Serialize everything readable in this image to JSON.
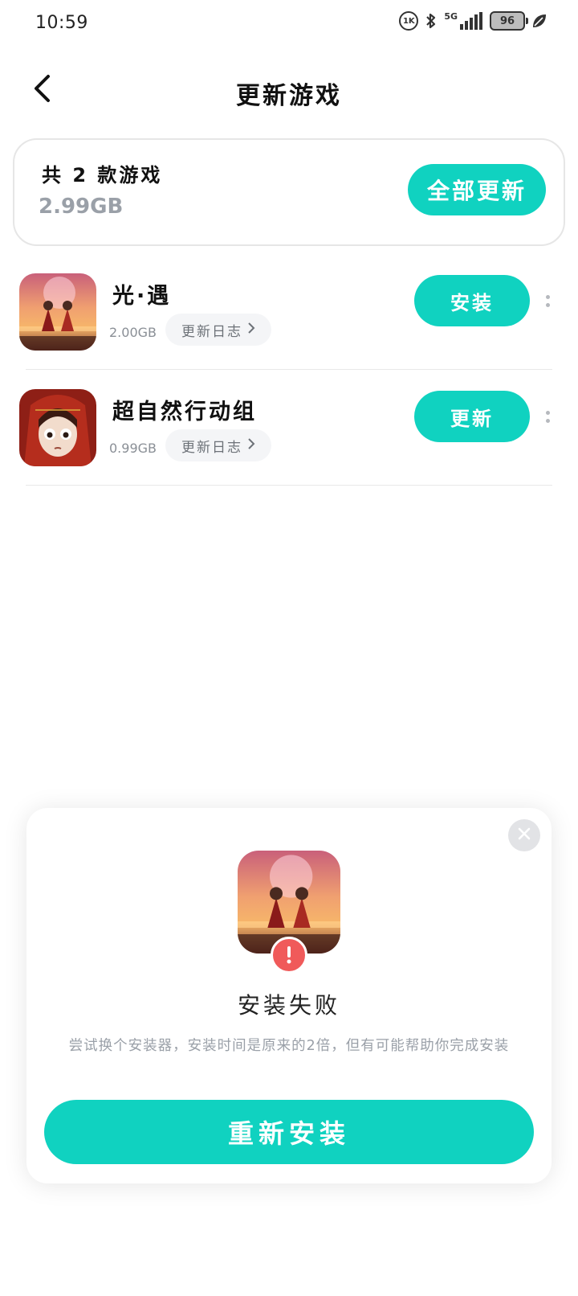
{
  "status_bar": {
    "time": "10:59",
    "hd_label": "1K",
    "network_label": "5G",
    "battery_level": "96",
    "icons": [
      "hd-icon",
      "bluetooth-icon",
      "signal-icon",
      "battery-icon",
      "leaf-icon"
    ]
  },
  "header": {
    "title": "更新游戏",
    "back_icon": "chevron-left-icon"
  },
  "summary": {
    "count_text": "共 2 款游戏",
    "total_size": "2.99GB",
    "update_all_label": "全部更新"
  },
  "games": [
    {
      "name": "光·遇",
      "size": "2.00GB",
      "changelog_label": "更新日志",
      "action_label": "安装",
      "icon": "sky-game-icon"
    },
    {
      "name": "超自然行动组",
      "size": "0.99GB",
      "changelog_label": "更新日志",
      "action_label": "更新",
      "icon": "supernatural-game-icon"
    }
  ],
  "dialog": {
    "title": "安装失败",
    "message": "尝试换个安装器，安装时间是原来的2倍，但有可能帮助你完成安装",
    "reinstall_label": "重新安装",
    "icon": "sky-game-icon",
    "badge_icon": "error-icon"
  },
  "colors": {
    "accent": "#10d2c0",
    "error": "#f05a5a",
    "muted_text": "#9aa0a8"
  }
}
